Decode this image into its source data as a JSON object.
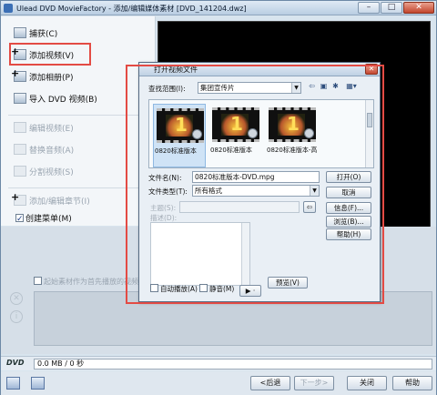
{
  "window": {
    "title": "Ulead DVD MovieFactory - 添加/编辑媒体素材    [DVD_141204.dwz]",
    "min": "–",
    "max": "□",
    "close": "✕"
  },
  "tasks": {
    "capture": "捕获(C)",
    "add_video": "添加视频(V)",
    "add_album": "添加相册(P)",
    "import_dvd": "导入 DVD 视频(B)",
    "edit_video": "编辑视频(E)",
    "replace_audio": "替换音频(A)",
    "split_video": "分割视频(S)",
    "add_chapter": "添加/编辑章节(I)",
    "create_menu": "创建菜单(M)",
    "create_menu_checked": true
  },
  "options": {
    "first_play": "起始素材作为首先播放的视频"
  },
  "dvd": {
    "label": "DVD",
    "usage": "0.0 MB / 0 秒"
  },
  "nav": {
    "back": "<后退",
    "next": "下一步>",
    "close": "关闭",
    "help": "帮助"
  },
  "dialog": {
    "title": "打开视频文件",
    "close": "✕",
    "look_in_label": "查找范围(I):",
    "look_in_value": "集团宣传片",
    "files": [
      {
        "name": "0820标准版本",
        "selected": true
      },
      {
        "name": "0820标准版本",
        "selected": false
      },
      {
        "name": "0820标准版本-高",
        "selected": false
      }
    ],
    "thumb_number": "1",
    "filename_label": "文件名(N):",
    "filename_value": "0820标准版本-DVD.mpg",
    "filetype_label": "文件类型(T):",
    "filetype_value": "所有格式",
    "subject_label": "主题(S):",
    "desc_label": "描述(D):",
    "open": "打开(O)",
    "cancel": "取消",
    "info": "信息(F)...",
    "browse": "浏览(B)...",
    "help": "帮助(H)",
    "autoplay": "自动播放(A)",
    "mute": "静音(M)",
    "preview": "预览(V)"
  },
  "watermark": "Baidu 经验"
}
